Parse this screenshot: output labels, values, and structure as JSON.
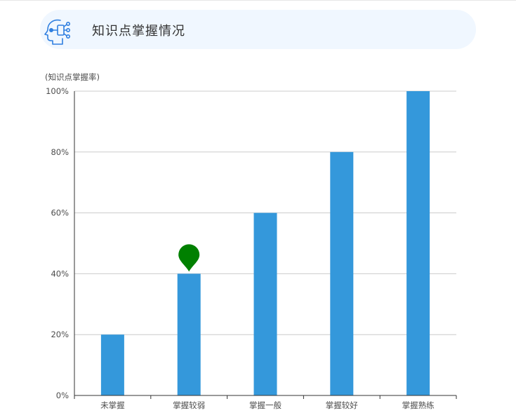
{
  "header": {
    "title": "知识点掌握情况",
    "icon": "ai-head-icon"
  },
  "chart_data": {
    "type": "bar",
    "title": "知识点掌握情况",
    "ylabel": "(知识点掌握率)",
    "xlabel": "",
    "categories": [
      "未掌握",
      "掌握较弱",
      "掌握一般",
      "掌握较好",
      "掌握熟练"
    ],
    "values": [
      20,
      40,
      60,
      80,
      100
    ],
    "ylim": [
      0,
      100
    ],
    "y_ticks": [
      0,
      20,
      40,
      60,
      80,
      100
    ],
    "y_tick_labels": [
      "0%",
      "20%",
      "40%",
      "60%",
      "80%",
      "100%"
    ],
    "grid": true,
    "bar_color": "#3498db",
    "marker": {
      "category": "掌握较弱",
      "value": 40,
      "color": "#008000",
      "icon": "map-pin-icon"
    }
  }
}
